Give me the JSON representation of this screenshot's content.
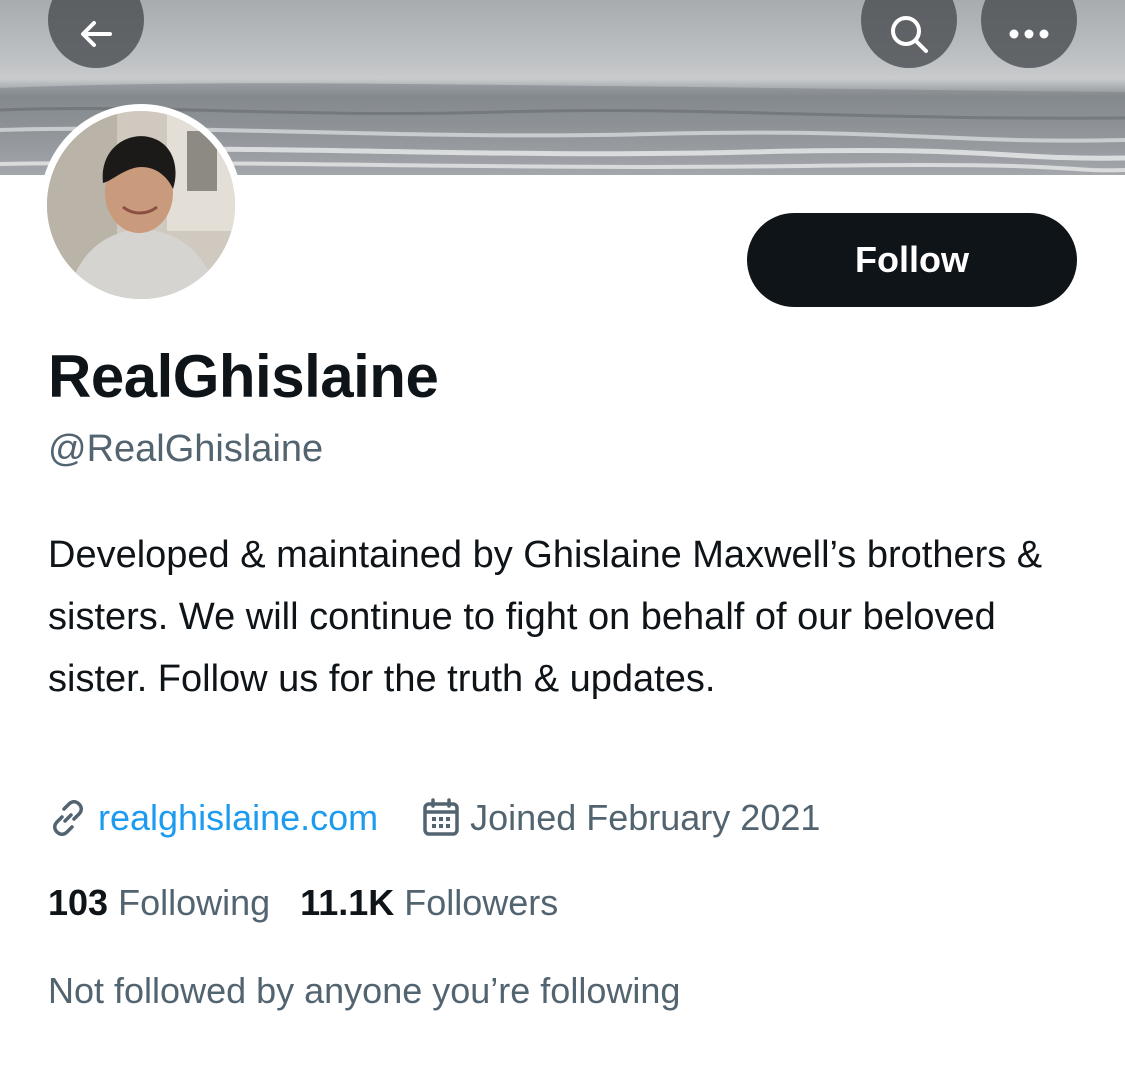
{
  "profile": {
    "display_name": "RealGhislaine",
    "handle": "@RealGhislaine",
    "bio": "Developed & maintained by Ghislaine Maxwell’s brothers & sisters. We will continue to fight on behalf of our beloved sister. Follow us for the truth & updates.",
    "website": "realghislaine.com",
    "joined": "Joined February 2021",
    "following_count": "103",
    "following_label": "Following",
    "followers_count": "11.1K",
    "followers_label": "Followers",
    "mutuals_text": "Not followed by anyone you’re following"
  },
  "actions": {
    "follow_label": "Follow"
  },
  "icons": {
    "back": "arrow-left-icon",
    "search": "search-icon",
    "more": "more-horizontal-icon",
    "link": "link-icon",
    "calendar": "calendar-icon"
  },
  "colors": {
    "text_primary": "#0f1419",
    "text_secondary": "#536471",
    "link": "#1d9bf0",
    "follow_button_bg": "#0f1419"
  }
}
